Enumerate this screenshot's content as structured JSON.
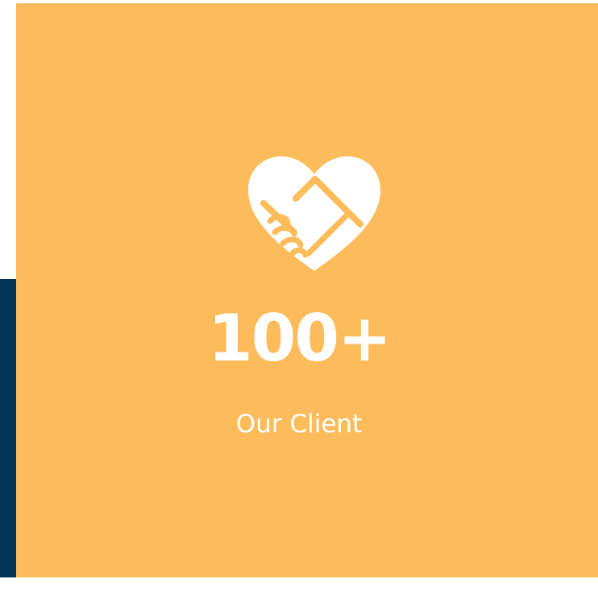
{
  "stat": {
    "number": "100+",
    "label": "Our Client",
    "icon": "handshake-heart-icon"
  },
  "colors": {
    "card_background": "#fdbc5b",
    "side_strip": "#023557",
    "text": "#ffffff"
  }
}
